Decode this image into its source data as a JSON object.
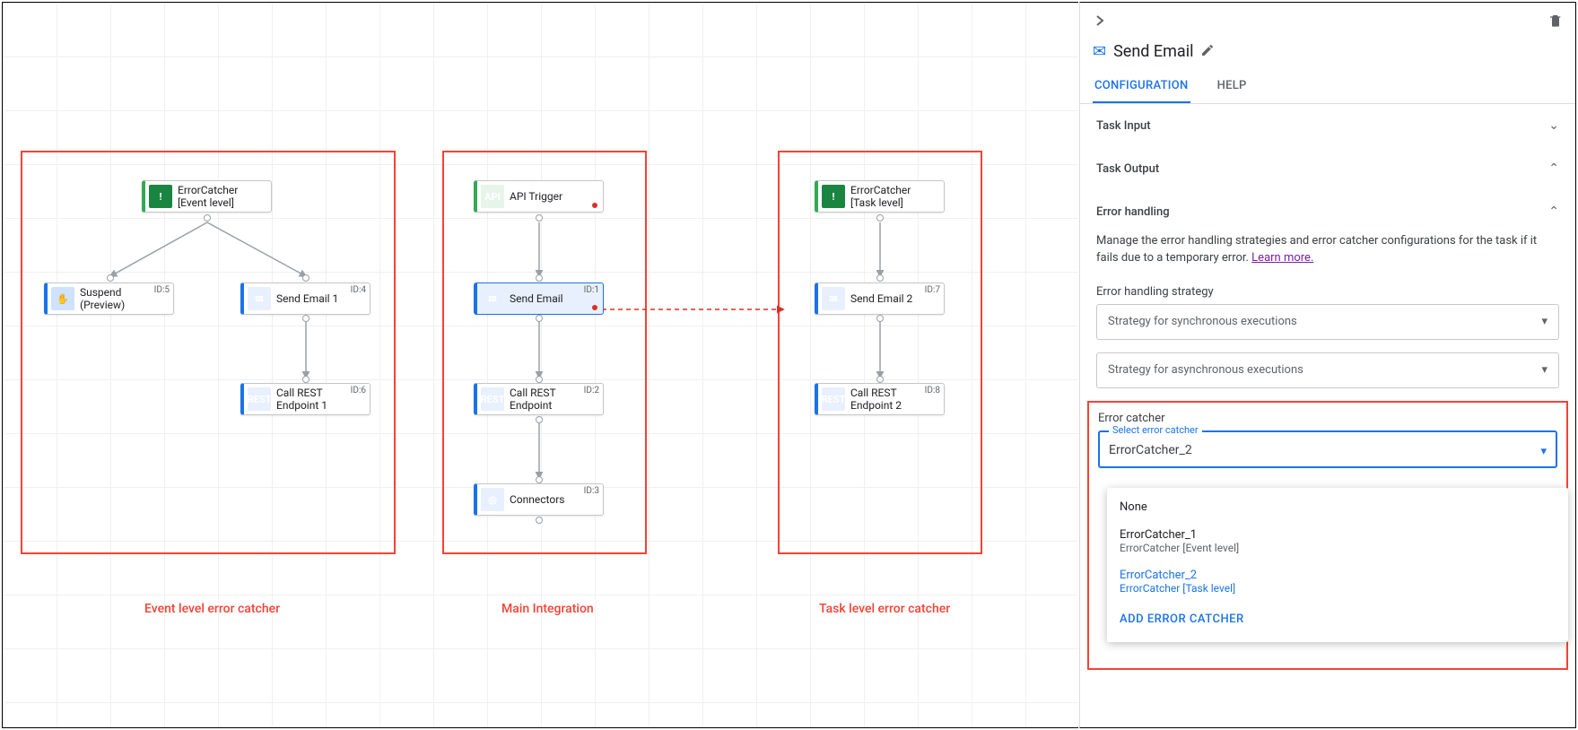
{
  "regions": {
    "left": {
      "label": "Event level error catcher"
    },
    "center": {
      "label": "Main Integration"
    },
    "right": {
      "label": "Task level error catcher"
    }
  },
  "nodes": {
    "errorCatcherEvent": {
      "line1": "ErrorCatcher",
      "line2": "[Event level]"
    },
    "suspend": {
      "line1": "Suspend",
      "line2": "(Preview)",
      "id": "ID:5"
    },
    "sendEmail1": {
      "line1": "Send Email 1",
      "id": "ID:4"
    },
    "callRest1": {
      "line1": "Call REST",
      "line2": "Endpoint 1",
      "id": "ID:6"
    },
    "apiTrigger": {
      "line1": "API Trigger"
    },
    "sendEmail": {
      "line1": "Send Email",
      "id": "ID:1"
    },
    "callRest": {
      "line1": "Call REST",
      "line2": "Endpoint",
      "id": "ID:2"
    },
    "connectors": {
      "line1": "Connectors",
      "id": "ID:3"
    },
    "errorCatcherTask": {
      "line1": "ErrorCatcher",
      "line2": "[Task level]"
    },
    "sendEmail2": {
      "line1": "Send Email 2",
      "id": "ID:7"
    },
    "callRest2": {
      "line1": "Call REST",
      "line2": "Endpoint 2",
      "id": "ID:8"
    }
  },
  "panel": {
    "title": "Send Email",
    "tabs": {
      "configuration": "CONFIGURATION",
      "help": "HELP"
    },
    "sections": {
      "taskInput": "Task Input",
      "taskOutput": "Task Output",
      "errorHandling": "Error handling"
    },
    "errorHandling": {
      "desc": "Manage the error handling strategies and error catcher configurations for the task if it fails due to a temporary error. ",
      "learnMore": "Learn more.",
      "strategyLabel": "Error handling strategy",
      "stratSync": "Strategy for synchronous executions",
      "stratAsync": "Strategy for asynchronous executions",
      "catcherLabel": "Error catcher",
      "selectCatcher": "Select error catcher",
      "selectedValue": "ErrorCatcher_2",
      "options": {
        "none": "None",
        "ec1": {
          "title": "ErrorCatcher_1",
          "sub": "ErrorCatcher [Event level]"
        },
        "ec2": {
          "title": "ErrorCatcher_2",
          "sub": "ErrorCatcher [Task level]"
        },
        "add": "ADD ERROR CATCHER"
      }
    }
  }
}
